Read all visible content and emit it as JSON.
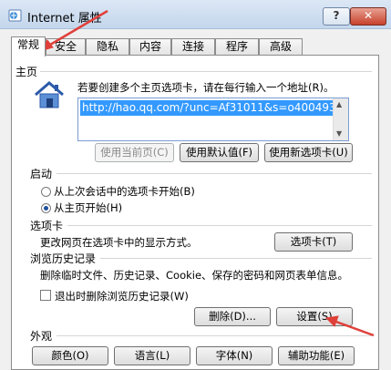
{
  "window": {
    "title": "Internet 属性",
    "help_label": "?",
    "close_label": "✕"
  },
  "tabs": [
    "常规",
    "安全",
    "隐私",
    "内容",
    "连接",
    "程序",
    "高级"
  ],
  "home": {
    "section_label": "主页",
    "instruction": "若要创建多个主页选项卡，请在每行输入一个地址(R)。",
    "url": "http://hao.qq.com/?unc=Af31011&s=o400493_",
    "buttons": {
      "use_current": "使用当前页(C)",
      "use_default": "使用默认值(F)",
      "use_new_tab": "使用新选项卡(U)"
    }
  },
  "startup": {
    "section_label": "启动",
    "options": [
      "从上次会话中的选项卡开始(B)",
      "从主页开始(H)"
    ],
    "selected_index": 1
  },
  "tabs_section": {
    "section_label": "选项卡",
    "text": "更改网页在选项卡中的显示方式。",
    "button": "选项卡(T)"
  },
  "history": {
    "section_label": "浏览历史记录",
    "text": "删除临时文件、历史记录、Cookie、保存的密码和网页表单信息。",
    "checkbox_label": "退出时删除浏览历史记录(W)",
    "checkbox_checked": false,
    "delete_button": "删除(D)...",
    "settings_button": "设置(S)"
  },
  "appearance": {
    "section_label": "外观",
    "buttons": [
      "颜色(O)",
      "语言(L)",
      "字体(N)",
      "辅助功能(E)"
    ]
  },
  "icons": {
    "app": "internet-options-icon",
    "home": "house-icon",
    "annotation": "red-arrow"
  },
  "colors": {
    "annotation": "#e0403a",
    "selection": "#3399ff"
  }
}
